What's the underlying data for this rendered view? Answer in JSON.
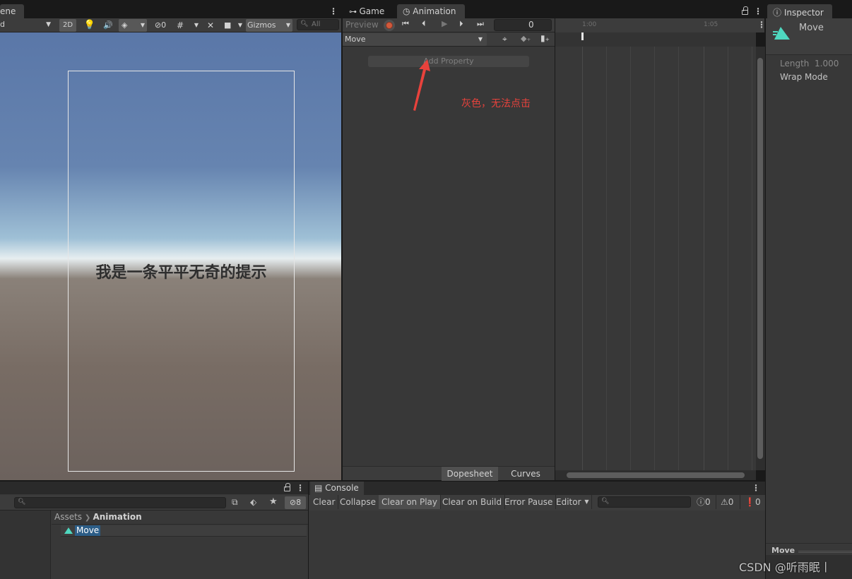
{
  "scene": {
    "tab_label": "ene",
    "shading_value": "d",
    "btn_2d": "2D",
    "hidden_count": "0",
    "gizmos_label": "Gizmos",
    "search_placeholder": "All",
    "canvas_text": "我是一条平平无奇的提示"
  },
  "animation": {
    "tab_game": "Game",
    "tab_animation": "Animation",
    "preview_label": "Preview",
    "frame_value": "0",
    "clip_name": "Move",
    "add_property": "Add Property",
    "annotation_note": "灰色，无法点击",
    "ruler_ticks": [
      "1:00",
      "1:05"
    ],
    "tab_dopesheet": "Dopesheet",
    "tab_curves": "Curves"
  },
  "inspector": {
    "tab_label": "Inspector",
    "asset_name": "Move",
    "length_label": "Length",
    "length_value": "1.000",
    "wrap_mode_label": "Wrap Mode",
    "footer_name": "Move"
  },
  "project": {
    "hidden_count": "8",
    "breadcrumb_root": "Assets",
    "breadcrumb_current": "Animation",
    "items": [
      "Move"
    ]
  },
  "console": {
    "tab_label": "Console",
    "buttons": [
      "Clear",
      "Collapse",
      "Clear on Play",
      "Clear on Build",
      "Error Pause",
      "Editor"
    ],
    "info_count": "0",
    "warn_count": "0",
    "error_count": "0"
  },
  "watermark": "CSDN @听雨眠丨",
  "colors": {
    "accent_teal": "#4fd8c0",
    "annotation_red": "#e8423c",
    "record_red": "#d05a3c",
    "selection_blue": "#2c5d87"
  }
}
